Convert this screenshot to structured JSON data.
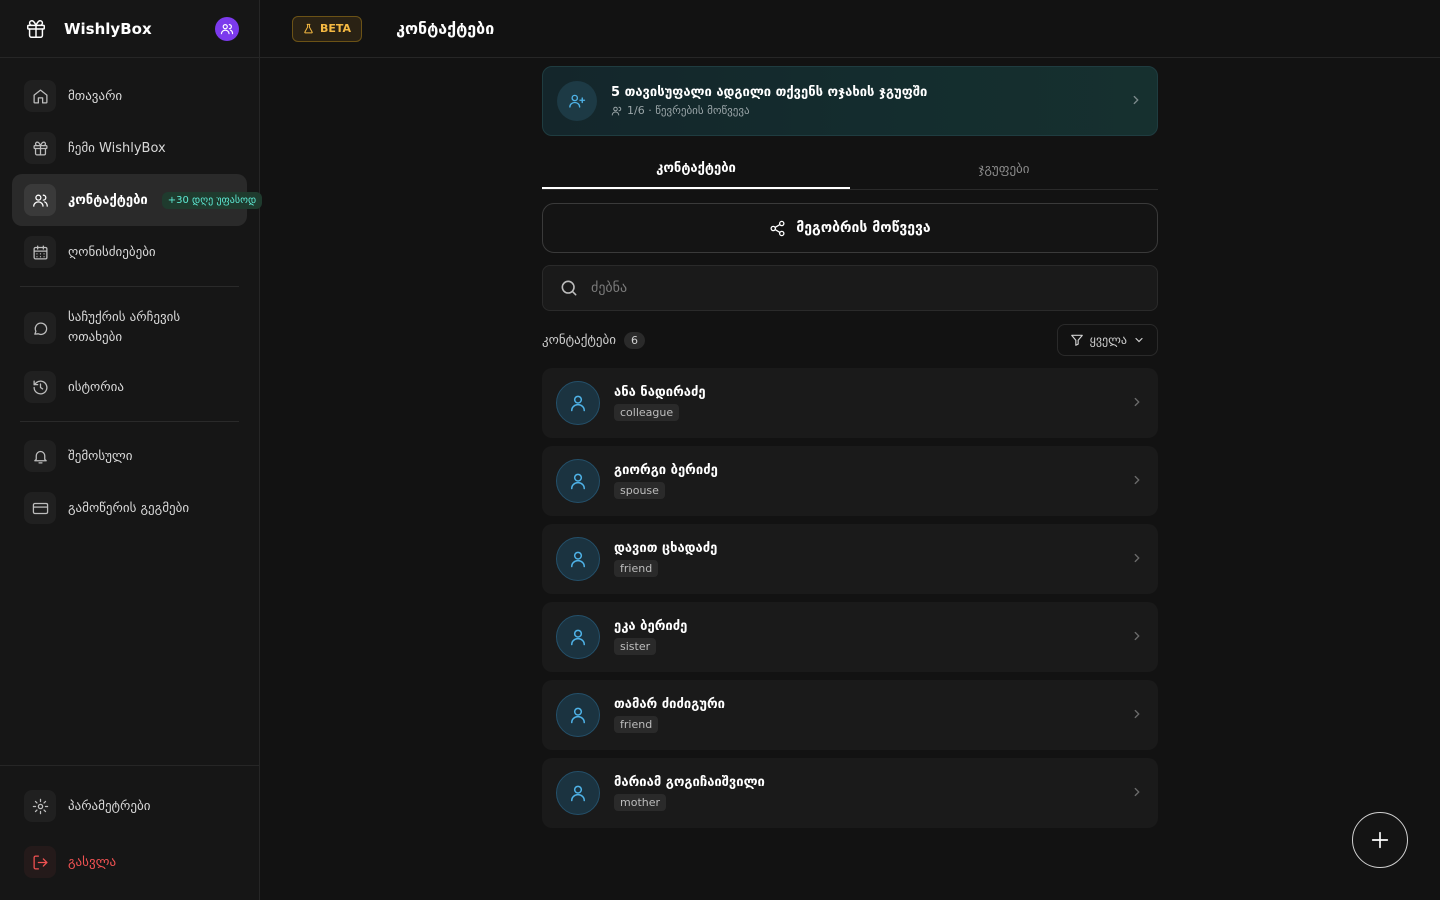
{
  "brand": {
    "name": "WishlyBox"
  },
  "sidebar": {
    "items": [
      {
        "label": "მთავარი",
        "icon": "home-icon"
      },
      {
        "label": "ჩემი WishlyBox",
        "icon": "gift-icon"
      },
      {
        "label": "კონტაქტები",
        "icon": "users-icon",
        "badge": "+30 დღე უფასოდ"
      },
      {
        "label": "ღონისძიებები",
        "icon": "calendar-icon"
      },
      {
        "label": "საჩუქრის არჩევის ოთახები",
        "icon": "chat-icon"
      },
      {
        "label": "ისტორია",
        "icon": "history-icon"
      },
      {
        "label": "შემოსული",
        "icon": "bell-icon"
      },
      {
        "label": "გამოწერის გეგმები",
        "icon": "credit-card-icon"
      }
    ],
    "bottom": [
      {
        "label": "პარამეტრები",
        "icon": "gear-icon"
      },
      {
        "label": "გასვლა",
        "icon": "logout-icon"
      }
    ]
  },
  "header": {
    "beta": "BETA",
    "title": "კონტაქტები"
  },
  "promo": {
    "title": "5 თავისუფალი ადგილი თქვენს ოჯახის ჯგუფში",
    "subtitle": "1/6 · წევრების მოწვევა"
  },
  "tabs": [
    {
      "label": "კონტაქტები"
    },
    {
      "label": "ჯგუფები"
    }
  ],
  "invite": {
    "label": "მეგობრის მოწვევა"
  },
  "search": {
    "placeholder": "ძებნა"
  },
  "list": {
    "title": "კონტაქტები",
    "count": "6",
    "filter": "ყველა"
  },
  "contacts": [
    {
      "name": "ანა ნადირაძე",
      "relation": "colleague"
    },
    {
      "name": "გიორგი ბერიძე",
      "relation": "spouse"
    },
    {
      "name": "დავით ცხადაძე",
      "relation": "friend"
    },
    {
      "name": "ეკა ბერიძე",
      "relation": "sister"
    },
    {
      "name": "თამარ ძიძიგური",
      "relation": "friend"
    },
    {
      "name": "მარიამ გოგიჩაიშვილი",
      "relation": "mother"
    }
  ],
  "colors": {
    "accent": "#7c3aed",
    "beta": "#f5b942",
    "avatar_icon": "#4fb3e8",
    "logout": "#f05252",
    "promo_badge": "#5eead4"
  }
}
